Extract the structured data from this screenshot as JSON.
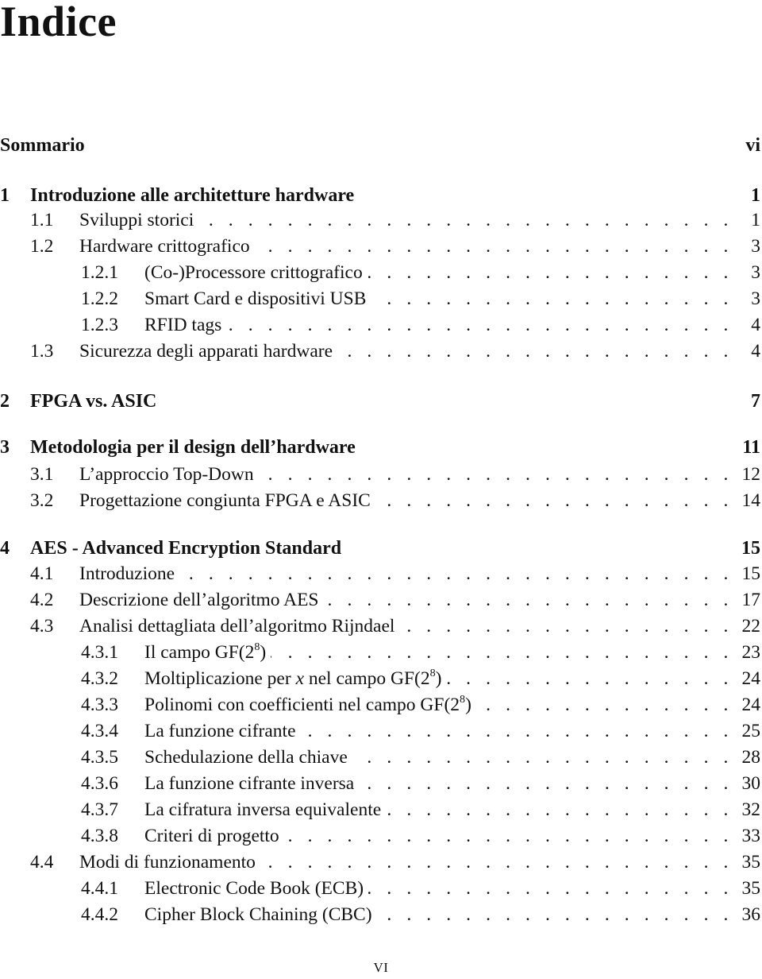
{
  "page_title": "Indice",
  "entries": [
    {
      "level": "chapter",
      "number": "",
      "title": "Sommario",
      "page": "vi",
      "leader": false
    },
    {
      "level": "chapter",
      "number": "1",
      "title": "Introduzione alle architetture hardware",
      "page": "1",
      "leader": false
    },
    {
      "level": "section",
      "number": "1.1",
      "title": "Sviluppi storici",
      "page": "1",
      "leader": true
    },
    {
      "level": "section",
      "number": "1.2",
      "title": "Hardware crittografico",
      "page": "3",
      "leader": true
    },
    {
      "level": "subsection",
      "number": "1.2.1",
      "title": "(Co-)Processore crittografico",
      "page": "3",
      "leader": true
    },
    {
      "level": "subsection",
      "number": "1.2.2",
      "title": "Smart Card e dispositivi USB",
      "page": "3",
      "leader": true
    },
    {
      "level": "subsection",
      "number": "1.2.3",
      "title": "RFID tags",
      "page": "4",
      "leader": true
    },
    {
      "level": "section",
      "number": "1.3",
      "title": "Sicurezza degli apparati hardware",
      "page": "4",
      "leader": true
    },
    {
      "level": "chapter",
      "number": "2",
      "title": "FPGA vs. ASIC",
      "page": "7",
      "leader": false
    },
    {
      "level": "chapter",
      "number": "3",
      "title": "Metodologia per il design dell’hardware",
      "page": "11",
      "leader": false
    },
    {
      "level": "section",
      "number": "3.1",
      "title": "L’approccio Top-Down",
      "page": "12",
      "leader": true
    },
    {
      "level": "section",
      "number": "3.2",
      "title": "Progettazione congiunta FPGA e ASIC",
      "page": "14",
      "leader": true
    },
    {
      "level": "chapter",
      "number": "4",
      "title": "AES - Advanced Encryption Standard",
      "page": "15",
      "leader": false
    },
    {
      "level": "section",
      "number": "4.1",
      "title": "Introduzione",
      "page": "15",
      "leader": true
    },
    {
      "level": "section",
      "number": "4.2",
      "title": "Descrizione dell’algoritmo AES",
      "page": "17",
      "leader": true
    },
    {
      "level": "section",
      "number": "4.3",
      "title": "Analisi dettagliata dell’algoritmo Rijndael",
      "page": "22",
      "leader": true
    },
    {
      "level": "subsection",
      "number": "4.3.1",
      "title": "Il campo GF(2^8)",
      "title_parts": [
        "Il campo GF(2",
        "8",
        ")"
      ],
      "page": "23",
      "leader": true
    },
    {
      "level": "subsection",
      "number": "4.3.2",
      "title": "Moltiplicazione per x nel campo GF(2^8)",
      "title_parts": [
        "Moltiplicazione per ",
        "x",
        " nel campo GF(2",
        "8",
        ")"
      ],
      "page": "24",
      "leader": true
    },
    {
      "level": "subsection",
      "number": "4.3.3",
      "title": "Polinomi con coefficienti nel campo GF(2^8)",
      "title_parts": [
        "Polinomi con coefficienti nel campo GF(2",
        "8",
        ")"
      ],
      "page": "24",
      "leader": true
    },
    {
      "level": "subsection",
      "number": "4.3.4",
      "title": "La funzione cifrante",
      "page": "25",
      "leader": true
    },
    {
      "level": "subsection",
      "number": "4.3.5",
      "title": "Schedulazione della chiave",
      "page": "28",
      "leader": true
    },
    {
      "level": "subsection",
      "number": "4.3.6",
      "title": "La funzione cifrante inversa",
      "page": "30",
      "leader": true
    },
    {
      "level": "subsection",
      "number": "4.3.7",
      "title": "La cifratura inversa equivalente",
      "page": "32",
      "leader": true
    },
    {
      "level": "subsection",
      "number": "4.3.8",
      "title": "Criteri di progetto",
      "page": "33",
      "leader": true
    },
    {
      "level": "section",
      "number": "4.4",
      "title": "Modi di funzionamento",
      "page": "35",
      "leader": true
    },
    {
      "level": "subsection",
      "number": "4.4.1",
      "title": "Electronic Code Book (ECB)",
      "page": "35",
      "leader": true
    },
    {
      "level": "subsection",
      "number": "4.4.2",
      "title": "Cipher Block Chaining (CBC)",
      "page": "36",
      "leader": true
    }
  ],
  "footer": {
    "page_number": "VI"
  }
}
